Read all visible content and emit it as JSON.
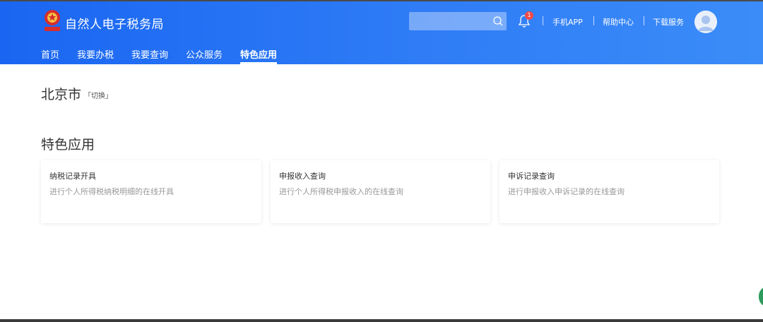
{
  "header": {
    "title": "自然人电子税务局",
    "notification_count": "1",
    "links": [
      "手机APP",
      "帮助中心",
      "下载服务"
    ],
    "colors": {
      "bar_start": "#1a66f2",
      "bar_end": "#3b8cf8"
    }
  },
  "nav": {
    "items": [
      {
        "label": "首页"
      },
      {
        "label": "我要办税"
      },
      {
        "label": "我要查询"
      },
      {
        "label": "公众服务"
      },
      {
        "label": "特色应用"
      }
    ],
    "active": "特色应用"
  },
  "location": {
    "city": "北京市",
    "switch_label": "「切换」"
  },
  "section": {
    "title": "特色应用"
  },
  "cards": [
    {
      "title": "纳税记录开具",
      "desc": "进行个人所得税纳税明细的在线开具"
    },
    {
      "title": "申报收入查询",
      "desc": "进行个人所得税申报收入的在线查询"
    },
    {
      "title": "申诉记录查询",
      "desc": "进行申报收入申诉记录的在线查询"
    }
  ],
  "icons": [
    "emblem-logo",
    "search-icon",
    "bell-icon",
    "avatar-icon"
  ]
}
